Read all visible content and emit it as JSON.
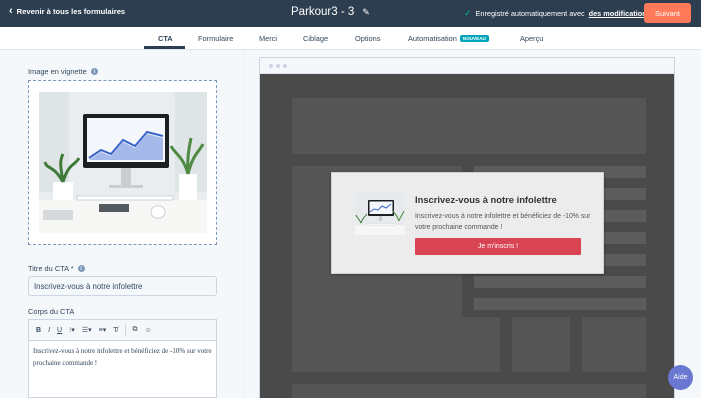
{
  "header": {
    "back_label": "Revenir à tous les formulaires",
    "form_title": "Parkour3 - 3",
    "autosave_text": "Enregistré automatiquement avec",
    "autosave_link": "des modifications n",
    "next_label": "Suivant"
  },
  "tabs": [
    {
      "label": "CTA",
      "active": true
    },
    {
      "label": "Formulaire"
    },
    {
      "label": "Merci"
    },
    {
      "label": "Ciblage"
    },
    {
      "label": "Options"
    },
    {
      "label": "Automatisation",
      "badge": "NOUVEAU"
    },
    {
      "label": "Aperçu"
    }
  ],
  "left": {
    "thumbnail_label": "Image en vignette",
    "cta_title_label": "Titre du CTA *",
    "cta_title_value": "Inscrivez-vous à notre infolettre",
    "body_label": "Corps du CTA",
    "body_text": "Inscrivez-vous à notre infolettre et bénéficiez de -10% sur votre prochaine commande !"
  },
  "toolbar": {
    "bold": "B",
    "italic": "I",
    "underline": "U"
  },
  "preview": {
    "popup_title": "Inscrivez-vous à notre infolettre",
    "popup_body": "Inscrivez-vous à notre infolettre et bénéficiez de -10% sur votre prochaine commande !",
    "popup_button": "Je m'inscris !"
  },
  "help_label": "Aide",
  "colors": {
    "header_bg": "#2d3e50",
    "accent": "#ff7a59",
    "cta_button": "#d94452",
    "help": "#6a78d1"
  }
}
